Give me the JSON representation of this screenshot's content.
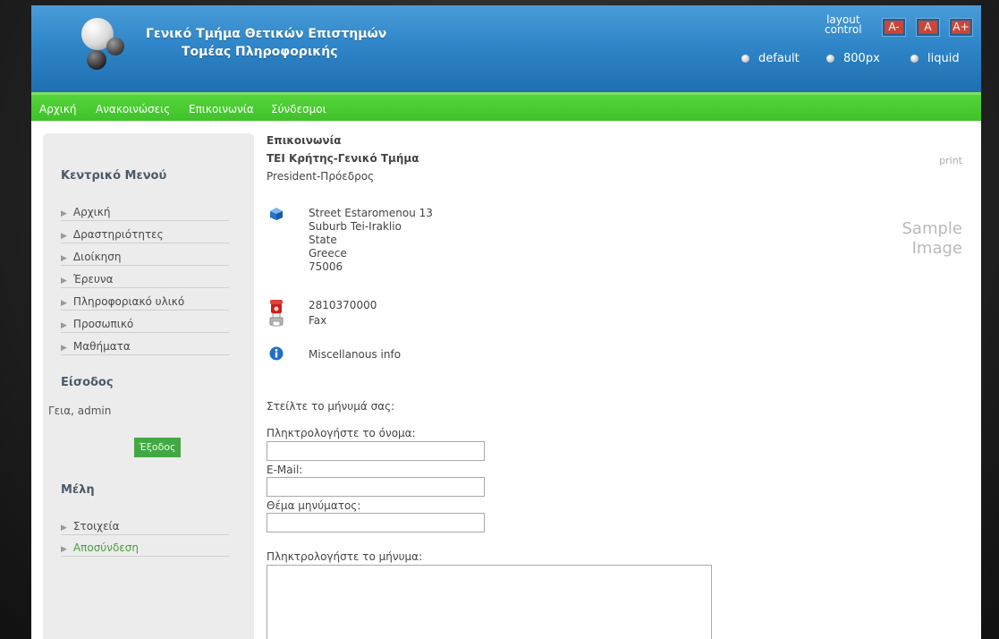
{
  "header": {
    "title_line1": "Γενικό Τμήμα Θετικών Επιστημών",
    "title_line2": "Τομέας Πληροφορικής",
    "layout_label_1": "layout",
    "layout_label_2": "control",
    "size_buttons": [
      "A-",
      "A",
      "A+"
    ],
    "width_options": [
      "default",
      "800px",
      "liquid"
    ]
  },
  "nav": {
    "items": [
      "Αρχική",
      "Ανακοινώσεις",
      "Επικοινωνία",
      "Σύνδεσμοι"
    ]
  },
  "sidebar": {
    "menu_title": "Κεντρικό Μενού",
    "menu_items": [
      "Αρχική",
      "Δραστηριότητες",
      "Διοίκηση",
      "Έρευνα",
      "Πληροφοριακό υλικό",
      "Προσωπικό",
      "Μαθήματα"
    ],
    "login_title": "Είσοδος",
    "greeting": "Γεια, admin",
    "logout_label": "Έξοδος",
    "members_title": "Μέλη",
    "member_items": [
      "Στοιχεία",
      "Αποσύνδεση"
    ]
  },
  "content": {
    "title": "Επικοινωνία",
    "org": "ΤΕΙ Κρήτης-Γενικό Τμήμα",
    "position": "President-Πρόεδρος",
    "print_label": "print",
    "sample_image_1": "Sample",
    "sample_image_2": "Image",
    "address": [
      "Street Estaromenou 13",
      "Suburb Tei-Iraklio",
      "State",
      "Greece",
      "75006"
    ],
    "phone": "2810370000",
    "fax": "Fax",
    "misc": "Miscellanous info",
    "form_intro": "Στείλτε το μήνυμά σας:",
    "name_label": "Πληκτρολογήστε το όνομα:",
    "email_label": "E-Mail:",
    "subject_label": "Θέμα μηνύματος:",
    "message_label": "Πληκτρολογήστε το μήνυμα:"
  },
  "colors": {
    "header_blue": "#2f86c8",
    "nav_green": "#44c52d",
    "logout_green": "#42a845"
  }
}
